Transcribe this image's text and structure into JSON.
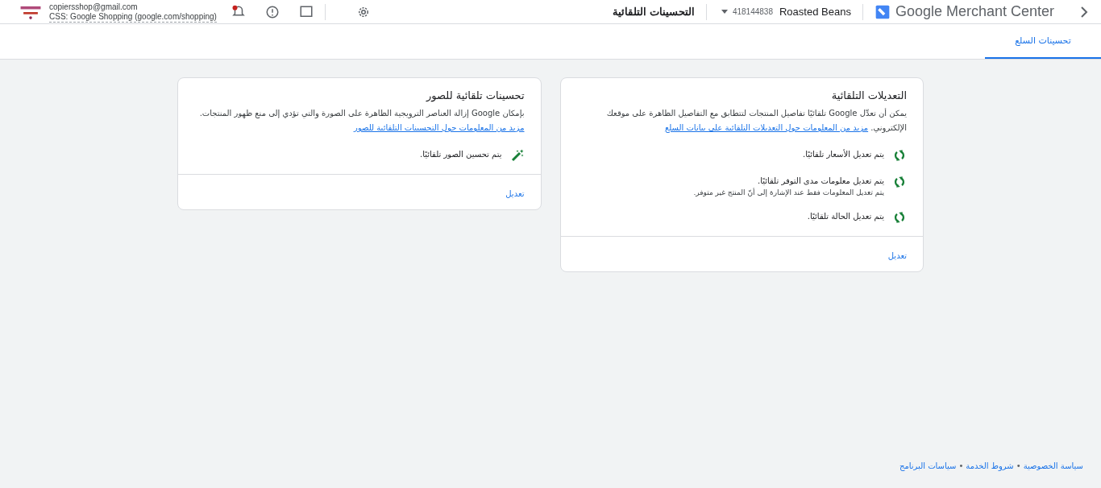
{
  "header": {
    "account_email": "copiersshop@gmail.com",
    "css_label": "CSS: Google Shopping (google.com/shopping)",
    "page_title": "التحسينات التلقائية",
    "account_id": "418144838",
    "account_name": "Roasted Beans",
    "product_name": "Google Merchant Center"
  },
  "tabs": [
    {
      "label": "تحسينات السلع",
      "selected": true
    }
  ],
  "cards": [
    {
      "title": "التعديلات التلقائية",
      "description": "يمكن أن تعدِّل Google تلقائيًا تفاصيل المنتجات لتتطابق مع التفاصيل الظاهرة على موقعك الإلكتروني.",
      "link": "مزيد من المعلومات حول التعديلات التلقائية على بيانات السلع",
      "items": [
        {
          "kind": "sync",
          "text": "يتم تعديل الأسعار تلقائيًا."
        },
        {
          "kind": "sync",
          "text": "يتم تعديل معلومات مدى التوفر تلقائيًا.",
          "note": "يتم تعديل المعلومات فقط عند الإشارة إلى أنّ المنتج غير متوفر."
        },
        {
          "kind": "sync",
          "text": "يتم تعديل الحالة تلقائيًا."
        }
      ],
      "action": "تعديل"
    },
    {
      "title": "تحسينات تلقائية للصور",
      "description": "بإمكان Google إزالة العناصر الترويجية الظاهرة على الصورة والتي تؤدي إلى منع ظهور المنتجات.",
      "link": "مزيد من المعلومات حول التحسينات التلقائية للصور",
      "items": [
        {
          "kind": "wand",
          "text": "يتم تحسين الصور تلقائيًا."
        }
      ],
      "action": "تعديل"
    }
  ],
  "footer_links": [
    "سياسة الخصوصية",
    "شروط الخدمة",
    "سياسات البرنامج"
  ],
  "footer_separator": "•"
}
